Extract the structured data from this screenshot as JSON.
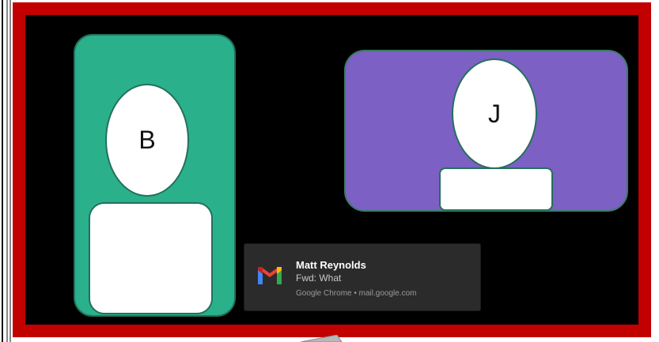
{
  "participants": [
    {
      "initial": "B",
      "color": "#2bb08c"
    },
    {
      "initial": "J",
      "color": "#7c60c4"
    }
  ],
  "notification": {
    "sender": "Matt Reynolds",
    "subject": "Fwd: What",
    "source": "Google Chrome • mail.google.com",
    "icon": "gmail-icon"
  },
  "colors": {
    "frame": "#c30000",
    "background": "#000000",
    "notification_bg": "#2b2b2b"
  }
}
